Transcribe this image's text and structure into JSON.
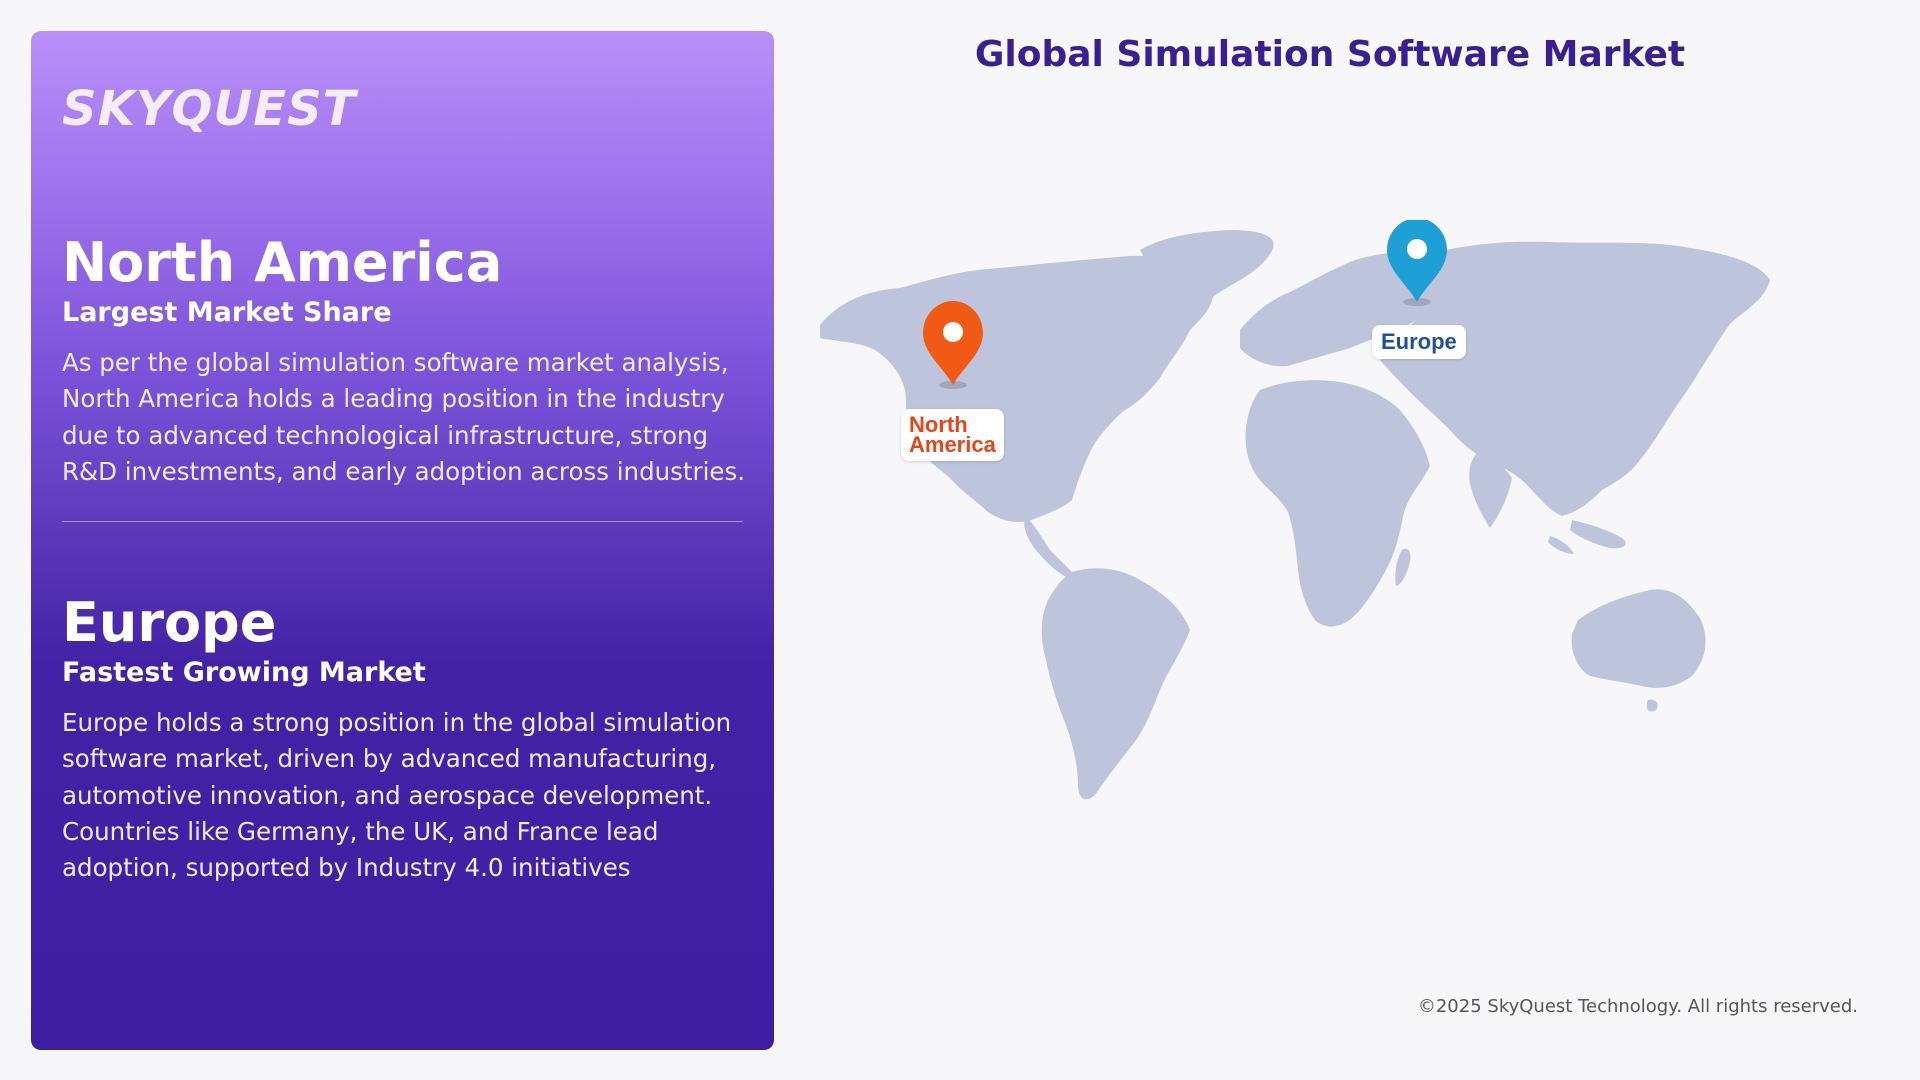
{
  "brand": {
    "logo_text": "SKYQUEST"
  },
  "title": "Global Simulation Software Market",
  "regions": [
    {
      "name": "North America",
      "tag": "Largest Market Share",
      "description": "As per the global simulation software market analysis, North America holds a leading position in the industry due to advanced technological infrastructure, strong R&D investments, and early adoption across industries."
    },
    {
      "name": "Europe",
      "tag": "Fastest Growing Market",
      "description": "Europe holds a strong position in the global simulation software market, driven by advanced manufacturing, automotive innovation, and aerospace development. Countries like Germany, the UK, and France lead adoption, supported by Industry 4.0 initiatives"
    }
  ],
  "map": {
    "pins": [
      {
        "label_line1": "North",
        "label_line2": "America",
        "color": "#f05a14"
      },
      {
        "label": "Europe",
        "color": "#1e9fd6"
      }
    ],
    "land_color": "#bfc4dd"
  },
  "footer": {
    "copyright": "©2025 SkyQuest Technology. All rights reserved."
  },
  "colors": {
    "panel_top": "#b88ff8",
    "panel_bottom": "#3d1ea0",
    "title": "#3a1f93"
  }
}
